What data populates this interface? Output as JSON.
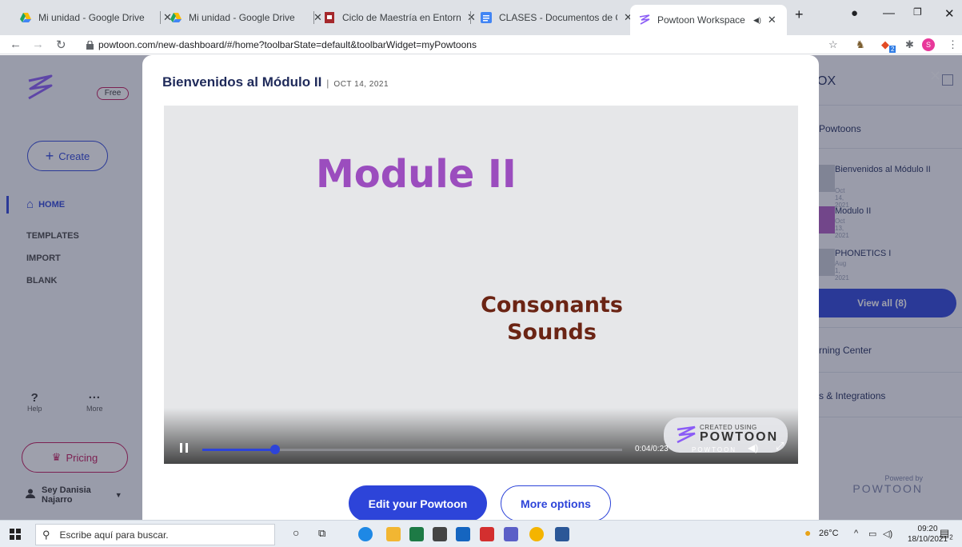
{
  "browser": {
    "tabs": [
      {
        "label": "Mi unidad - Google Drive",
        "icon": "google-drive-icon"
      },
      {
        "label": "Mi unidad - Google Drive",
        "icon": "google-drive-icon"
      },
      {
        "label": "Ciclo de Maestría en Entornos",
        "icon": "doc-red-icon"
      },
      {
        "label": "CLASES - Documentos de Go",
        "icon": "google-docs-icon"
      },
      {
        "label": "Powtoon Workspace",
        "icon": "powtoon-icon",
        "active": true
      }
    ],
    "url": "powtoon.com/new-dashboard/#/home?toolbarState=default&toolbarWidget=myPowtoons",
    "profile_initial": "S",
    "extension_badge": "2"
  },
  "sidebar": {
    "free_badge": "Free",
    "create_label": "Create",
    "nav": [
      {
        "label": "HOME",
        "active": true
      },
      {
        "label": "TEMPLATES"
      },
      {
        "label": "IMPORT"
      },
      {
        "label": "BLANK"
      }
    ],
    "help_label": "Help",
    "more_label": "More",
    "pricing_label": "Pricing",
    "user_first": "Sey Danisia",
    "user_last": "Najarro"
  },
  "right_panel": {
    "title": "OX",
    "powtoons_section": "Powtoons",
    "items": [
      {
        "name": "Bienvenidos al Módulo II",
        "date": "Oct 14, 2021"
      },
      {
        "name": "Modulo II",
        "date": "Oct 13, 2021"
      },
      {
        "name": "PHONETICS I",
        "date": "Aug 1, 2021"
      }
    ],
    "view_all": "View all (8)",
    "learning_center": "rning Center",
    "integrations": "s & Integrations",
    "powered_by": "Powered by",
    "powered_brand": "POWTOON"
  },
  "modal": {
    "title": "Bienvenidos al Módulo II",
    "date": "OCT 14, 2021",
    "video": {
      "heading": "Module II",
      "subheading_line1": "Consonants",
      "subheading_line2": "Sounds",
      "time": "0:04/0:23",
      "progress": 0.1739,
      "badge_small": "CREATED USING",
      "badge_brand": "POWTOON",
      "watermark": "POWTOON"
    },
    "edit_button": "Edit your Powtoon",
    "more_button": "More options"
  },
  "taskbar": {
    "search_placeholder": "Escribe aquí para buscar.",
    "temperature": "26°C",
    "time": "09:20",
    "date": "18/10/2021",
    "notification_count": "2"
  },
  "colors": {
    "accent": "#2d44d9",
    "pricing": "#c2185b",
    "video_heading": "#9b4dbe",
    "video_sub": "#6b2414"
  }
}
